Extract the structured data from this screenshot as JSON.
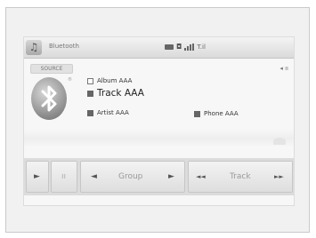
{
  "header": {
    "music_tab_icon": "music-note-icon",
    "source_title": "Bluetooth",
    "status_text": "T.il"
  },
  "source_tab_label": "SOURCE",
  "speaker": {
    "icon": "speaker-icon",
    "level": "ıı"
  },
  "bluetooth": {
    "icon": "bluetooth-icon",
    "reg_mark": "®"
  },
  "track_info": {
    "album": "Album AAA",
    "track": "Track AAA",
    "artist": "Artist AAA",
    "phone": "Phone AAA"
  },
  "controls": {
    "play": "►",
    "pause": "ıı",
    "group_prev": "◄",
    "group_label": "Group",
    "group_next": "►",
    "track_prev": "◄◄",
    "track_label": "Track",
    "track_next": "►►"
  }
}
